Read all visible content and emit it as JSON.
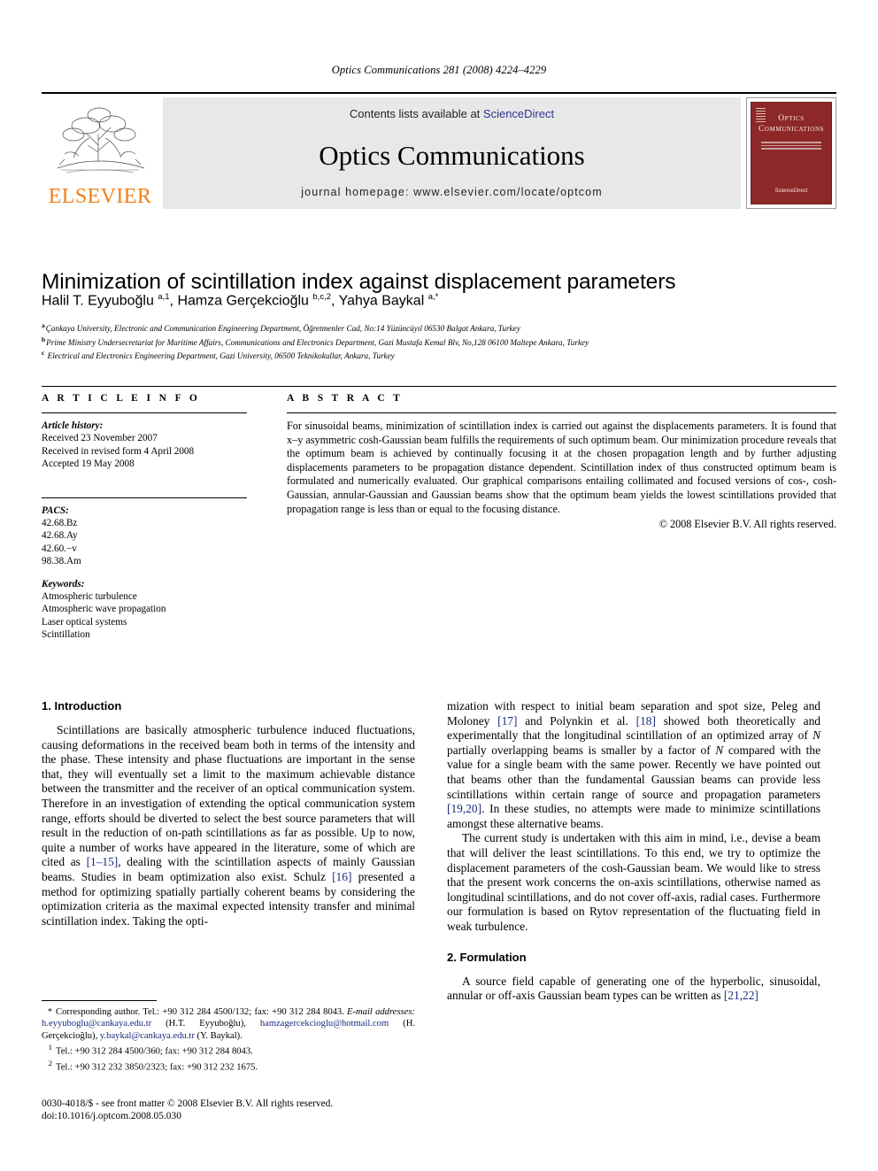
{
  "running_head": "Optics Communications 281 (2008) 4224–4229",
  "masthead": {
    "publisher": "ELSEVIER",
    "contents_prefix": "Contents lists available at ",
    "contents_link": "ScienceDirect",
    "journal_title": "Optics Communications",
    "homepage": "journal homepage: www.elsevier.com/locate/optcom",
    "cover_title_line1": "Optics",
    "cover_title_line2": "Communications",
    "cover_logo": "ScienceDirect",
    "cover_color": "#8e2828",
    "elsevier_color": "#F07F13",
    "link_color": "#2e3192"
  },
  "article": {
    "title": "Minimization of scintillation index against displacement parameters",
    "authors_html": "Halil T. Eyyuboğlu <sup>a,1</sup>, Hamza Gerçekcioğlu <sup>b,c,2</sup>, Yahya Baykal <sup>a,</sup><sup>*</sup>",
    "affiliations": [
      {
        "mark": "a",
        "text": "Çankaya University, Electronic and Communication Engineering Department, Öğretmenler Cad, No:14 Yüzüncüyıl 06530 Balgat Ankara, Turkey"
      },
      {
        "mark": "b",
        "text": "Prime Ministry Undersecretariat for Maritime Affairs, Communications and Electronics Department, Gazi Mustafa Kemal Blv, No,128 06100 Maltepe Ankara, Turkey"
      },
      {
        "mark": "c",
        "text": "Electrical and Electronics Engineering Department, Gazi University, 06500 Teknikokullar, Ankara, Turkey"
      }
    ]
  },
  "article_info": {
    "label": "A R T I C L E   I N F O",
    "history_head": "Article history:",
    "history": [
      "Received 23 November 2007",
      "Received in revised form 4 April 2008",
      "Accepted 19 May 2008"
    ],
    "pacs_head": "PACS:",
    "pacs": [
      "42.68.Bz",
      "42.68.Ay",
      "42.60.−v",
      "98.38.Am"
    ],
    "keywords_head": "Keywords:",
    "keywords": [
      "Atmospheric turbulence",
      "Atmospheric wave propagation",
      "Laser optical systems",
      "Scintillation"
    ]
  },
  "abstract": {
    "label": "A B S T R A C T",
    "text": "For sinusoidal beams, minimization of scintillation index is carried out against the displacements parameters. It is found that x–y asymmetric cosh-Gaussian beam fulfills the requirements of such optimum beam. Our minimization procedure reveals that the optimum beam is achieved by continually focusing it at the chosen propagation length and by further adjusting displacements parameters to be propagation distance dependent. Scintillation index of thus constructed optimum beam is formulated and numerically evaluated. Our graphical comparisons entailing collimated and focused versions of cos-, cosh-Gaussian, annular-Gaussian and Gaussian beams show that the optimum beam yields the lowest scintillations provided that propagation range is less than or equal to the focusing distance.",
    "copyright": "© 2008 Elsevier B.V. All rights reserved."
  },
  "sections": {
    "intro_heading": "1. Introduction",
    "intro_p1_a": "Scintillations are basically atmospheric turbulence induced fluctuations, causing deformations in the received beam both in terms of the intensity and the phase. These intensity and phase fluctuations are important in the sense that, they will eventually set a limit to the maximum achievable distance between the transmitter and the receiver of an optical communication system. Therefore in an investigation of extending the optical communication system range, efforts should be diverted to select the best source parameters that will result in the reduction of on-path scintillations as far as possible. Up to now, quite a number of works have appeared in the literature, some of which are cited as ",
    "ref_1_15": "[1–15]",
    "intro_p1_b": ", dealing with the scintillation aspects of mainly Gaussian beams. Studies in beam optimization also exist. Schulz ",
    "ref_16": "[16]",
    "intro_p1_c": " presented a method for optimizing spatially partially coherent beams by considering the optimization criteria as the maximal expected intensity transfer and minimal scintillation index. Taking the opti-",
    "intro_p1_d": "mization with respect to initial beam separation and spot size, Peleg and Moloney ",
    "ref_17": "[17]",
    "intro_p1_e": " and Polynkin et al. ",
    "ref_18": "[18]",
    "intro_p1_f": " showed both theoretically and experimentally that the longitudinal scintillation of an optimized array of ",
    "italic_N1": "N",
    "intro_p1_g": " partially overlapping beams is smaller by a factor of ",
    "italic_N2": "N",
    "intro_p1_h": " compared with the value for a single beam with the same power. Recently we have pointed out that beams other than the fundamental Gaussian beams can provide less scintillations within certain range of source and propagation parameters ",
    "ref_19_20": "[19,20]",
    "intro_p1_i": ". In these studies, no attempts were made to minimize scintillations amongst these alternative beams.",
    "intro_p2": "The current study is undertaken with this aim in mind, i.e., devise a beam that will deliver the least scintillations. To this end, we try to optimize the displacement parameters of the cosh-Gaussian beam. We would like to stress that the present work concerns the on-axis scintillations, otherwise named as longitudinal scintillations, and do not cover off-axis, radial cases. Furthermore our formulation is based on Rytov representation of the fluctuating field in weak turbulence.",
    "formulation_heading": "2. Formulation",
    "formulation_p1": "A source field capable of generating one of the hyperbolic, sinusoidal, annular or off-axis Gaussian beam types can be written as ",
    "ref_21_22": "[21,22]"
  },
  "footnotes": {
    "corresponding": "Corresponding author. Tel.: +90 312 284 4500/132; fax: +90 312 284 8043.",
    "email_label": "E-mail addresses:",
    "email1": "h.eyyuboglu@cankaya.edu.tr",
    "email1_owner": " (H.T. Eyyuboğlu), ",
    "email2": "hamzagercekcioglu@hotmail.com",
    "email2_owner": " (H. Gerçekcioğlu), ",
    "email3": "y.baykal@cankaya.edu.tr",
    "email3_owner": " (Y. Baykal).",
    "note1_mark": "1",
    "note1": "Tel.: +90 312 284 4500/360; fax: +90 312 284 8043.",
    "note2_mark": "2",
    "note2": "Tel.: +90 312 232 3850/2323; fax: +90 312 232 1675.",
    "star": "*"
  },
  "imprint": {
    "line1": "0030-4018/$ - see front matter © 2008 Elsevier B.V. All rights reserved.",
    "line2": "doi:10.1016/j.optcom.2008.05.030"
  }
}
